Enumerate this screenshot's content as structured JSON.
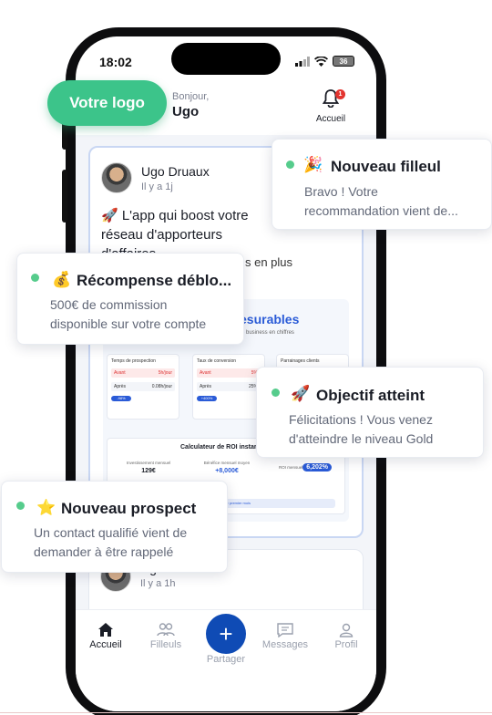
{
  "status": {
    "time": "18:02",
    "battery": "36"
  },
  "header": {
    "greeting": "Bonjour,",
    "name": "Ugo",
    "notif_count": "1",
    "home_label": "Accueil"
  },
  "logo": {
    "label": "Votre logo"
  },
  "post1": {
    "author": "Ugo Druaux",
    "ago": "Il y a 1j",
    "title": "🚀 L'app qui boost votre réseau d'apporteurs d'affaires",
    "subtitle_tail": "s en plus",
    "image": {
      "title": "esurables",
      "subtitle": "re business en chiffres",
      "cards": [
        {
          "title": "Temps de prospection",
          "avant_label": "Avant",
          "avant_value": "5h/jour",
          "apres_label": "Après",
          "apres_value": "0.08h/jour",
          "badge": "-98%"
        },
        {
          "title": "Taux de conversion",
          "avant_label": "Avant",
          "avant_value": "5%",
          "apres_label": "Après",
          "apres_value": "25%",
          "badge": "+400%"
        },
        {
          "title": "Parrainages clients",
          "avant_label": "",
          "avant_value": "",
          "apres_label": "",
          "apres_value": "",
          "badge": ""
        }
      ],
      "roi": {
        "title": "Calculateur de ROI instar",
        "cols": [
          {
            "label": "Investissement mensuel",
            "value": "129€",
            "note": ""
          },
          {
            "label": "Bénéfice mensuel moyen",
            "value": "+8,000€",
            "note": ""
          },
          {
            "label": "ROI mensuel",
            "value": "6,202%",
            "note": ""
          }
        ],
        "footer": "0h/mois dès le premier mois"
      }
    }
  },
  "post2": {
    "author": "Ugo Druaux",
    "ago": "Il y a 1h"
  },
  "fab": {
    "icon": "+"
  },
  "nav": {
    "items": [
      {
        "label": "Accueil",
        "icon": "⌂"
      },
      {
        "label": "Filleuls",
        "icon": "👥"
      },
      {
        "label": "Messages",
        "icon": "▤"
      },
      {
        "label": "Profil",
        "icon": "👤"
      }
    ],
    "share_label": "Partager",
    "share_icon": "+"
  },
  "notifications": [
    {
      "emoji": "🎉",
      "title": "Nouveau filleul",
      "line1": "Bravo ! Votre",
      "line2": "recommandation vient de..."
    },
    {
      "emoji": "💰",
      "title": "Récompense déblo...",
      "line1": "500€ de commission",
      "line2": "disponible sur votre compte"
    },
    {
      "emoji": "🚀",
      "title": "Objectif atteint",
      "line1": "Félicitations ! Vous venez",
      "line2": "d'atteindre le niveau Gold"
    },
    {
      "emoji": "⭐",
      "title": "Nouveau prospect",
      "line1": "Un contact qualifié vient de",
      "line2": "demander à être rappelé"
    }
  ],
  "colors": {
    "brand_green": "#3cc48a",
    "brand_blue": "#0f4bb5",
    "dot_green": "#56cc8c",
    "alert_red": "#e3342f"
  }
}
